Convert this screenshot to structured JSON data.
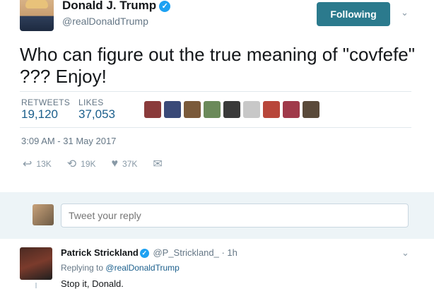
{
  "tweet": {
    "author_name": "Donald J. Trump",
    "author_handle": "@realDonaldTrump",
    "follow_label": "Following",
    "text": "Who can figure out the true meaning of \"covfefe\" ???  Enjoy!",
    "retweets_label": "RETWEETS",
    "retweets_value": "19,120",
    "likes_label": "LIKES",
    "likes_value": "37,053",
    "timestamp": "3:09 AM - 31 May 2017",
    "actions": {
      "reply_count": "13K",
      "retweet_count": "19K",
      "like_count": "37K"
    },
    "liker_colors": [
      "#8a3b3b",
      "#3a4a78",
      "#7a5a3a",
      "#6b8a5a",
      "#3a3a3a",
      "#c8c8c8",
      "#b8463a",
      "#a03a4a",
      "#5a4a3a"
    ]
  },
  "reply_box": {
    "placeholder": "Tweet your reply"
  },
  "reply_tweet": {
    "author_name": "Patrick Strickland",
    "author_handle": "@P_Strickland_",
    "time": "· 1h",
    "replying_prefix": "Replying to",
    "replying_to": "@realDonaldTrump",
    "text": "Stop it, Donald."
  },
  "icons": {
    "verified": "✓",
    "caret": "⌄",
    "reply": "↩",
    "retweet": "⟲",
    "like": "♥",
    "message": "✉"
  }
}
